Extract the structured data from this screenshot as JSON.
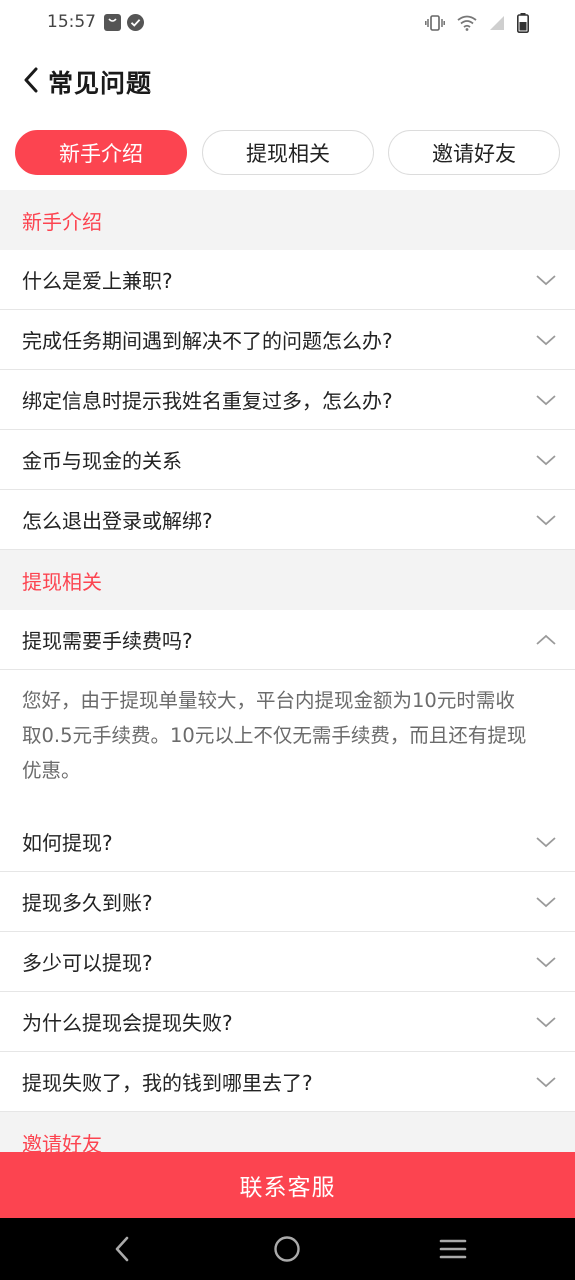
{
  "status_bar": {
    "time": "15:57",
    "icons": [
      "notification-bag-icon",
      "check-circle-icon",
      "vibrate-icon",
      "wifi-icon",
      "signal-icon",
      "battery-icon"
    ]
  },
  "header": {
    "title": "常见问题",
    "back_icon": "back-arrow-icon"
  },
  "tabs": [
    {
      "label": "新手介绍",
      "active": true
    },
    {
      "label": "提现相关",
      "active": false
    },
    {
      "label": "邀请好友",
      "active": false
    }
  ],
  "sections": [
    {
      "title": "新手介绍",
      "items": [
        {
          "question": "什么是爱上兼职?"
        },
        {
          "question": "完成任务期间遇到解决不了的问题怎么办?"
        },
        {
          "question": "绑定信息时提示我姓名重复过多，怎么办?"
        },
        {
          "question": "金币与现金的关系"
        },
        {
          "question": "怎么退出登录或解绑?"
        }
      ]
    },
    {
      "title": "提现相关",
      "items": [
        {
          "question": "提现需要手续费吗?",
          "expanded": true,
          "answer_lines": [
            "您好，由于提现单量较大，平台内提现金额为10元时需收",
            "取0.5元手续费。10元以上不仅无需手续费，而且还有提现",
            "优惠。"
          ]
        },
        {
          "question": "如何提现?"
        },
        {
          "question": "提现多久到账?"
        },
        {
          "question": "多少可以提现?"
        },
        {
          "question": "为什么提现会提现失败?"
        },
        {
          "question": "提现失败了，我的钱到哪里去了?"
        }
      ]
    },
    {
      "title": "邀请好友",
      "items": []
    }
  ],
  "contact_button": {
    "label": "联系客服"
  },
  "nav_bar": {
    "icons": [
      "nav-back-icon",
      "nav-home-icon",
      "nav-recents-icon"
    ]
  },
  "colors": {
    "accent": "#fc4450",
    "section_bg": "#f3f3f3",
    "answer_text": "#6b6b6b"
  }
}
